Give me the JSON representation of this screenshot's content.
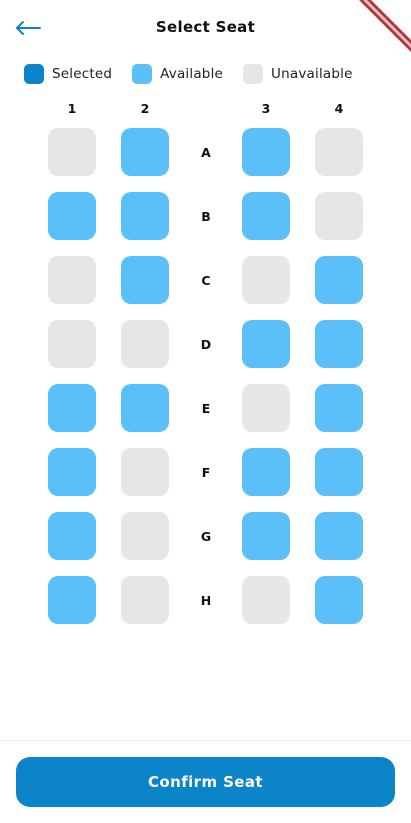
{
  "header": {
    "title": "Select Seat",
    "back_icon": "arrow-left-icon"
  },
  "legend": [
    {
      "label": "Selected",
      "color": "#0b84c9"
    },
    {
      "label": "Available",
      "color": "#5bc0f8"
    },
    {
      "label": "Unavailable",
      "color": "#e6e6e6"
    }
  ],
  "columns": [
    "1",
    "2",
    "3",
    "4"
  ],
  "rows": [
    {
      "label": "A",
      "seats": [
        "unavailable",
        "available",
        "available",
        "unavailable"
      ]
    },
    {
      "label": "B",
      "seats": [
        "available",
        "available",
        "available",
        "unavailable"
      ]
    },
    {
      "label": "C",
      "seats": [
        "unavailable",
        "available",
        "unavailable",
        "available"
      ]
    },
    {
      "label": "D",
      "seats": [
        "unavailable",
        "unavailable",
        "available",
        "available"
      ]
    },
    {
      "label": "E",
      "seats": [
        "available",
        "available",
        "unavailable",
        "available"
      ]
    },
    {
      "label": "F",
      "seats": [
        "available",
        "unavailable",
        "available",
        "available"
      ]
    },
    {
      "label": "G",
      "seats": [
        "available",
        "unavailable",
        "available",
        "available"
      ]
    },
    {
      "label": "H",
      "seats": [
        "available",
        "unavailable",
        "unavailable",
        "available"
      ]
    }
  ],
  "confirm_button": {
    "label": "Confirm Seat"
  },
  "colors": {
    "primary": "#0b84c9",
    "available": "#5bc0f8",
    "unavailable": "#e6e6e6"
  }
}
